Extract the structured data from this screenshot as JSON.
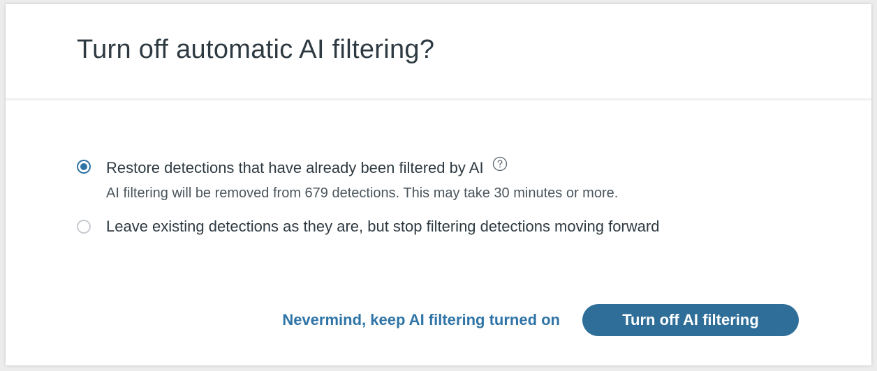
{
  "dialog": {
    "title": "Turn off automatic AI filtering?",
    "options": [
      {
        "label": "Restore detections that have already been filtered by AI",
        "description": "AI filtering will be removed from 679 detections. This may take 30 minutes or more.",
        "selected": true,
        "icon": "help-circle-icon"
      },
      {
        "label": "Leave existing detections as they are, but stop filtering detections moving forward",
        "selected": false
      }
    ],
    "cancel_label": "Nevermind, keep AI filtering turned on",
    "confirm_label": "Turn off AI filtering"
  },
  "colors": {
    "accent": "#2f74a6",
    "primary_button": "#2f6e99",
    "text": "#2e3a42"
  }
}
